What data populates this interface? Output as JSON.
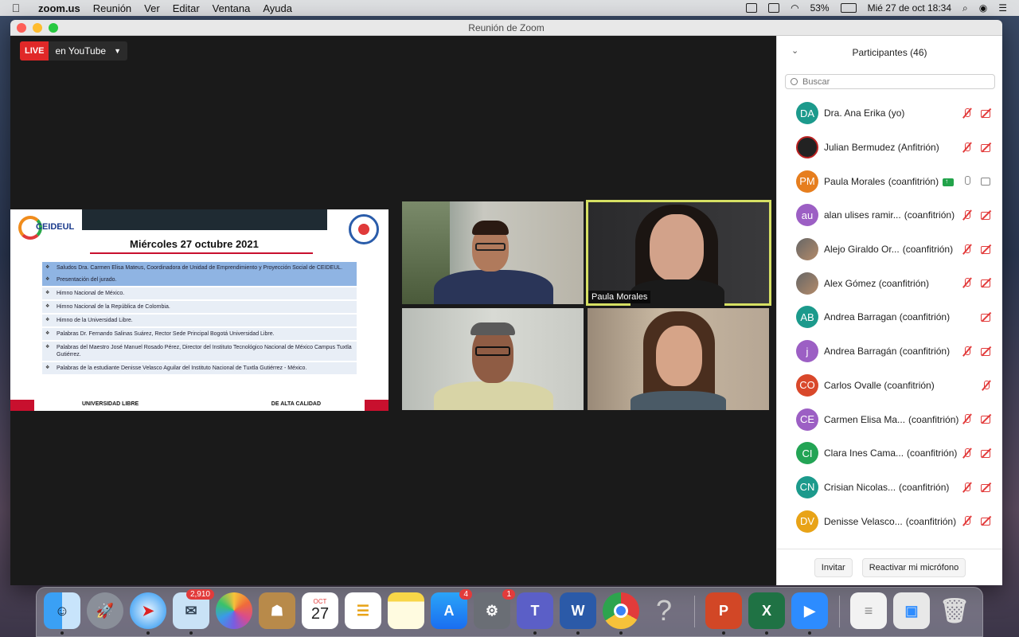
{
  "menubar": {
    "apple": "",
    "app_name": "zoom.us",
    "menus": [
      "Reunión",
      "Ver",
      "Editar",
      "Ventana",
      "Ayuda"
    ],
    "battery": "53%",
    "datetime": "Mié 27 de oct  18:34"
  },
  "window": {
    "title": "Reunión de Zoom"
  },
  "live": {
    "badge": "LIVE",
    "label": "en YouTube"
  },
  "slide": {
    "logo_left": "CEIDEUL",
    "heading": "Miércoles 27 octubre 2021",
    "agenda": [
      "Saludos Dra. Carmen Elisa Mateus, Coordinadora de Unidad de Emprendimiento y Proyección Social de CEIDEUL.",
      "Presentación del jurado.",
      "Himno Nacional de México.",
      "Himno Nacional de la República de Colombia.",
      "Himno de la Universidad Libre.",
      "Palabras Dr. Fernando Salinas Suárez, Rector Sede Principal Bogotá Universidad Libre.",
      "Palabras del Maestro José Manuel Rosado Pérez, Director del Instituto Tecnológico Nacional de México Campus Tuxtla Gutiérrez.",
      "Palabras de la estudiante Denisse Velasco Aguilar del Instituto Nacional de Tuxtla Gutiérrez - México."
    ],
    "footer_left": "UNIVERSIDAD LIBRE",
    "footer_right": "DE ALTA CALIDAD"
  },
  "tiles": {
    "active_name": "Paula Morales"
  },
  "participants": {
    "title": "Participantes (46)",
    "search_placeholder": "Buscar",
    "rows": [
      {
        "initials": "DA",
        "color": "#1c9a8c",
        "name": "Dra. Ana Erika (yo)",
        "role": "",
        "mic": "muted",
        "cam": "off"
      },
      {
        "initials": "",
        "color": "#222222",
        "name": "Julian Bermudez (Anfitrión)",
        "role": "",
        "mic": "muted",
        "cam": "off",
        "avatar": "logo"
      },
      {
        "initials": "PM",
        "color": "#e67e1e",
        "name": "Paula Morales",
        "role": "(coanfitrión)",
        "mic": "on",
        "cam": "on",
        "share": true
      },
      {
        "initials": "au",
        "color": "#9c5fc4",
        "name": "alan ulises ramir...",
        "role": "(coanfitrión)",
        "mic": "muted",
        "cam": "off"
      },
      {
        "initials": "",
        "color": "#777777",
        "name": "Alejo Giraldo Or...",
        "role": "(coanfitrión)",
        "mic": "muted",
        "cam": "off",
        "avatar": "photo"
      },
      {
        "initials": "",
        "color": "#777777",
        "name": "Alex Gómez (coanfitrión)",
        "role": "",
        "mic": "muted",
        "cam": "off",
        "avatar": "photo"
      },
      {
        "initials": "AB",
        "color": "#1c9a8c",
        "name": "Andrea Barragan (coanfitrión)",
        "role": "",
        "mic": "none",
        "cam": "off"
      },
      {
        "initials": "j",
        "color": "#9c5fc4",
        "name": "Andrea Barragán (coanfitrión)",
        "role": "",
        "mic": "muted",
        "cam": "off"
      },
      {
        "initials": "CO",
        "color": "#d9482b",
        "name": "Carlos Ovalle (coanfitrión)",
        "role": "",
        "mic": "muted",
        "cam": "none"
      },
      {
        "initials": "CE",
        "color": "#9c5fc4",
        "name": "Carmen Elisa Ma...",
        "role": "(coanfitrión)",
        "mic": "muted",
        "cam": "off"
      },
      {
        "initials": "CI",
        "color": "#23a455",
        "name": "Clara Ines Cama...",
        "role": "(coanfitrión)",
        "mic": "muted",
        "cam": "off"
      },
      {
        "initials": "CN",
        "color": "#1c9a8c",
        "name": "Crisian Nicolas...",
        "role": "(coanfitrión)",
        "mic": "muted",
        "cam": "off"
      },
      {
        "initials": "DV",
        "color": "#e8a317",
        "name": "Denisse Velasco...",
        "role": "(coanfitrión)",
        "mic": "muted",
        "cam": "off"
      }
    ],
    "invite_label": "Invitar",
    "unmute_label": "Reactivar mi micrófono"
  },
  "dock": {
    "mail_badge": "2,910",
    "appstore_badge": "4",
    "prefs_badge": "1",
    "calendar_month": "OCT",
    "calendar_day": "27"
  }
}
